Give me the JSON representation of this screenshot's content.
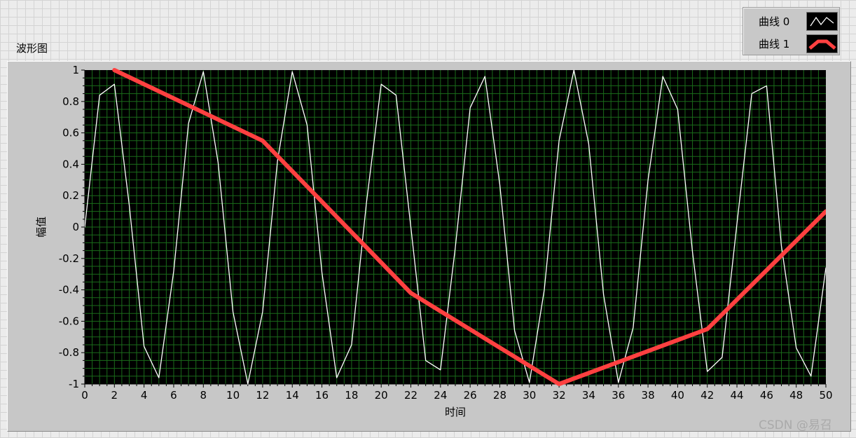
{
  "chart_data": {
    "type": "line",
    "title": "波形图",
    "xlabel": "时间",
    "ylabel": "幅值",
    "xlim": [
      0,
      50
    ],
    "ylim": [
      -1,
      1
    ],
    "x_ticks": [
      0,
      2,
      4,
      6,
      8,
      10,
      12,
      14,
      16,
      18,
      20,
      22,
      24,
      26,
      28,
      30,
      32,
      34,
      36,
      38,
      40,
      42,
      44,
      46,
      48,
      50
    ],
    "x_tick_labels": [
      "0",
      "2",
      "4",
      "6",
      "8",
      "10",
      "12",
      "14",
      "16",
      "18",
      "20",
      "22",
      "24",
      "26",
      "28",
      "30",
      "32",
      "34",
      "36",
      "38",
      "40",
      "42",
      "44",
      "46",
      "48",
      "50"
    ],
    "y_ticks": [
      1,
      0.8,
      0.6,
      0.4,
      0.2,
      0,
      -0.2,
      -0.4,
      -0.6,
      -0.8,
      -1
    ],
    "y_tick_labels": [
      "1",
      "0.8",
      "0.6",
      "0.4",
      "0.2",
      "0",
      "-0.2",
      "-0.4",
      "-0.6",
      "-0.8",
      "-1"
    ],
    "grid": true,
    "legend_position": "top-right",
    "background": "#000000",
    "grid_color": "#1a6b1a",
    "series": [
      {
        "name": "曲线 0",
        "color": "#ffffff",
        "x": [
          0,
          1,
          2,
          3,
          4,
          5,
          6,
          7,
          8,
          9,
          10,
          11,
          12,
          13,
          14,
          15,
          16,
          17,
          18,
          19,
          20,
          21,
          22,
          23,
          24,
          25,
          26,
          27,
          28,
          29,
          30,
          31,
          32,
          33,
          34,
          35,
          36,
          37,
          38,
          39,
          40,
          41,
          42,
          43,
          44,
          45,
          46,
          47,
          48,
          49,
          50
        ],
        "values": [
          0,
          0.84,
          0.91,
          0.14,
          -0.76,
          -0.96,
          -0.28,
          0.66,
          0.99,
          0.41,
          -0.54,
          -1,
          -0.54,
          0.42,
          0.99,
          0.65,
          -0.29,
          -0.96,
          -0.75,
          0.15,
          0.91,
          0.84,
          0,
          -0.85,
          -0.91,
          -0.13,
          0.76,
          0.96,
          0.27,
          -0.66,
          -0.99,
          -0.4,
          0.55,
          1,
          0.53,
          -0.43,
          -0.99,
          -0.64,
          0.3,
          0.96,
          0.75,
          -0.16,
          -0.92,
          -0.83,
          0.02,
          0.85,
          0.9,
          -0.12,
          -0.77,
          -0.95,
          -0.26
        ]
      },
      {
        "name": "曲线 1",
        "color": "#ff4040",
        "x": [
          2,
          12,
          22,
          32,
          42,
          50
        ],
        "values": [
          1,
          0.55,
          -0.42,
          -1,
          -0.65,
          0.1
        ]
      }
    ]
  },
  "watermark": "CSDN @易召"
}
